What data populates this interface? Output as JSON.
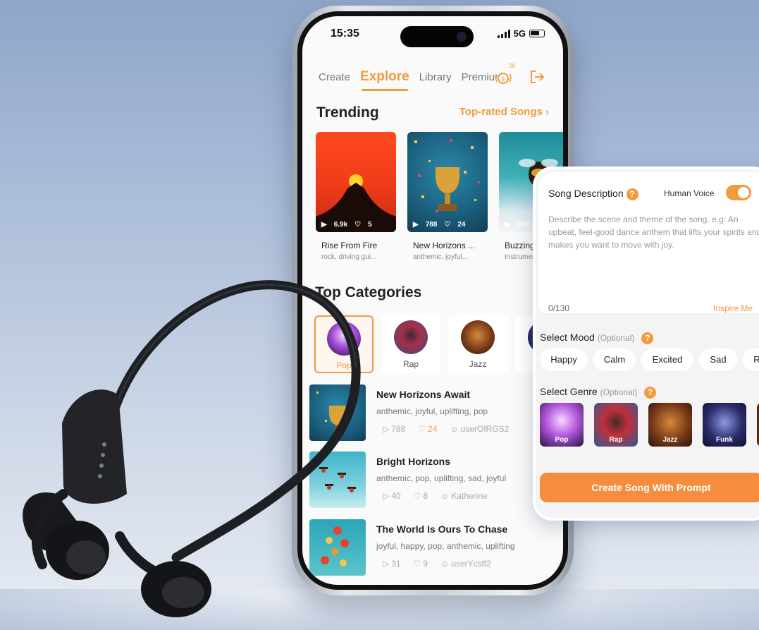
{
  "status": {
    "time": "15:35",
    "network": "5G"
  },
  "nav": {
    "tabs": [
      "Create",
      "Explore",
      "Library",
      "Premiur"
    ],
    "active": "Explore",
    "coin_count": "28"
  },
  "trending": {
    "title": "Trending",
    "link": "Top-rated Songs",
    "cards": [
      {
        "plays": "6.9k",
        "likes": "5",
        "title": "Rise From Fire",
        "tags": "rock, driving gui..."
      },
      {
        "plays": "788",
        "likes": "24",
        "title": "New Horizons ...",
        "tags": "anthemic, joyful..."
      },
      {
        "plays": "600",
        "likes": "",
        "title": "Buzzing S",
        "tags": "Instrumen"
      }
    ]
  },
  "categories": {
    "title": "Top Categories",
    "items": [
      "Pop",
      "Rap",
      "Jazz",
      "Fu"
    ]
  },
  "songs": [
    {
      "title": "New Horizons Await",
      "tags": "anthemic, joyful, uplifting, pop",
      "plays": "788",
      "likes": "24",
      "user": "userOfRGS2"
    },
    {
      "title": "Bright Horizons",
      "tags": "anthemic, pop, uplifting, sad, joyful",
      "plays": "40",
      "likes": "8",
      "user": "Katherine"
    },
    {
      "title": "The World Is Ours To Chase",
      "tags": "joyful, happy, pop, anthemic, uplifting",
      "plays": "31",
      "likes": "9",
      "user": "userYcsff2"
    }
  ],
  "panel": {
    "description_label": "Song Description",
    "human_voice_label": "Human Voice",
    "human_voice_on": true,
    "placeholder": "Describe the scene and theme of the song. e.g: An upbeat, feel-good dance anthem that lifts your spirits and makes you want to move with joy.",
    "counter": "0/130",
    "inspire": "Inspire Me",
    "mood_label": "Select Mood",
    "mood_optional": "(Optional)",
    "moods": [
      "Happy",
      "Calm",
      "Excited",
      "Sad",
      "R"
    ],
    "genre_label": "Select Genre",
    "genre_optional": "(Optional)",
    "genres": [
      "Pop",
      "Rap",
      "Jazz",
      "Funk"
    ],
    "create_button": "Create Song With Prompt"
  },
  "colors": {
    "accent": "#f39a3c",
    "button": "#f68c3d"
  }
}
